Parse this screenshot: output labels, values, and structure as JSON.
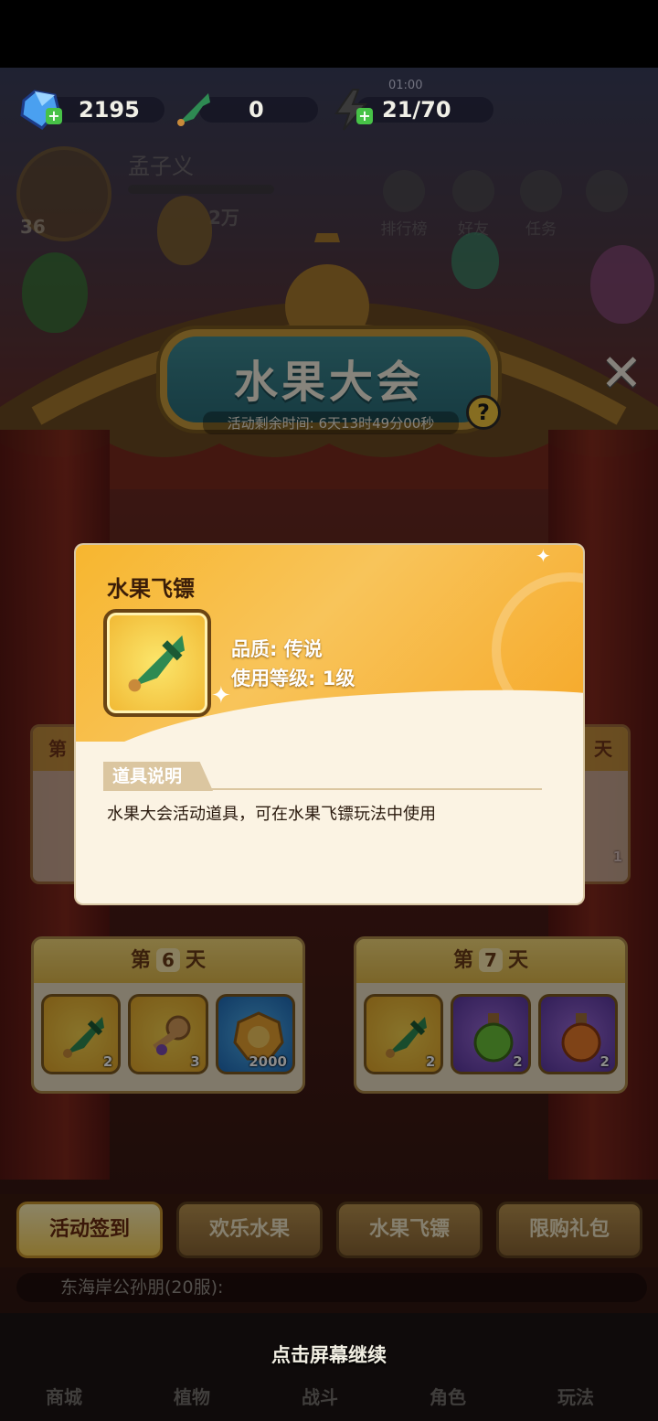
{
  "resources": {
    "gems": "2195",
    "darts": "0",
    "energy": "21/70",
    "energy_timer": "01:00"
  },
  "profile": {
    "name": "孟子义",
    "level": "36",
    "power": "2万"
  },
  "top_icons": [
    "排行榜",
    "好友",
    "任务"
  ],
  "banner": {
    "title": "水果大会",
    "remaining": "活动剩余时间: 6天13时49分00秒",
    "help_label": "?"
  },
  "days": [
    {
      "prefix": "第",
      "num": "6",
      "suffix": "天",
      "items": [
        {
          "icon": "dart-icon",
          "count": "2",
          "bg": "gold"
        },
        {
          "icon": "key-icon",
          "count": "3",
          "bg": "gold"
        },
        {
          "icon": "coin-icon",
          "count": "2000",
          "bg": "blue"
        }
      ]
    },
    {
      "prefix": "第",
      "num": "7",
      "suffix": "天",
      "items": [
        {
          "icon": "dart-icon",
          "count": "2",
          "bg": "gold"
        },
        {
          "icon": "green-potion-icon",
          "count": "2",
          "bg": "purple"
        },
        {
          "icon": "orange-potion-icon",
          "count": "2",
          "bg": "purple"
        }
      ]
    }
  ],
  "side_cards": {
    "left_head": "第",
    "right_head": "天",
    "right_count": "1"
  },
  "popup": {
    "title": "水果飞镖",
    "quality": "品质: 传说",
    "level": "使用等级: 1级",
    "desc_header": "道具说明",
    "desc": "水果大会活动道具，可在水果飞镖玩法中使用"
  },
  "tabs": [
    "活动签到",
    "欢乐水果",
    "水果飞镖",
    "限购礼包"
  ],
  "chat": "东海岸公孙朋(20服):",
  "continue_hint": "点击屏幕继续",
  "nav": [
    "商城",
    "植物",
    "战斗",
    "角色",
    "玩法"
  ],
  "colors": {
    "popup_accent": "#f7b62f",
    "gold_slot": "#f1b732",
    "blue_slot": "#1f6bb8",
    "purple_slot": "#5b38a0"
  }
}
